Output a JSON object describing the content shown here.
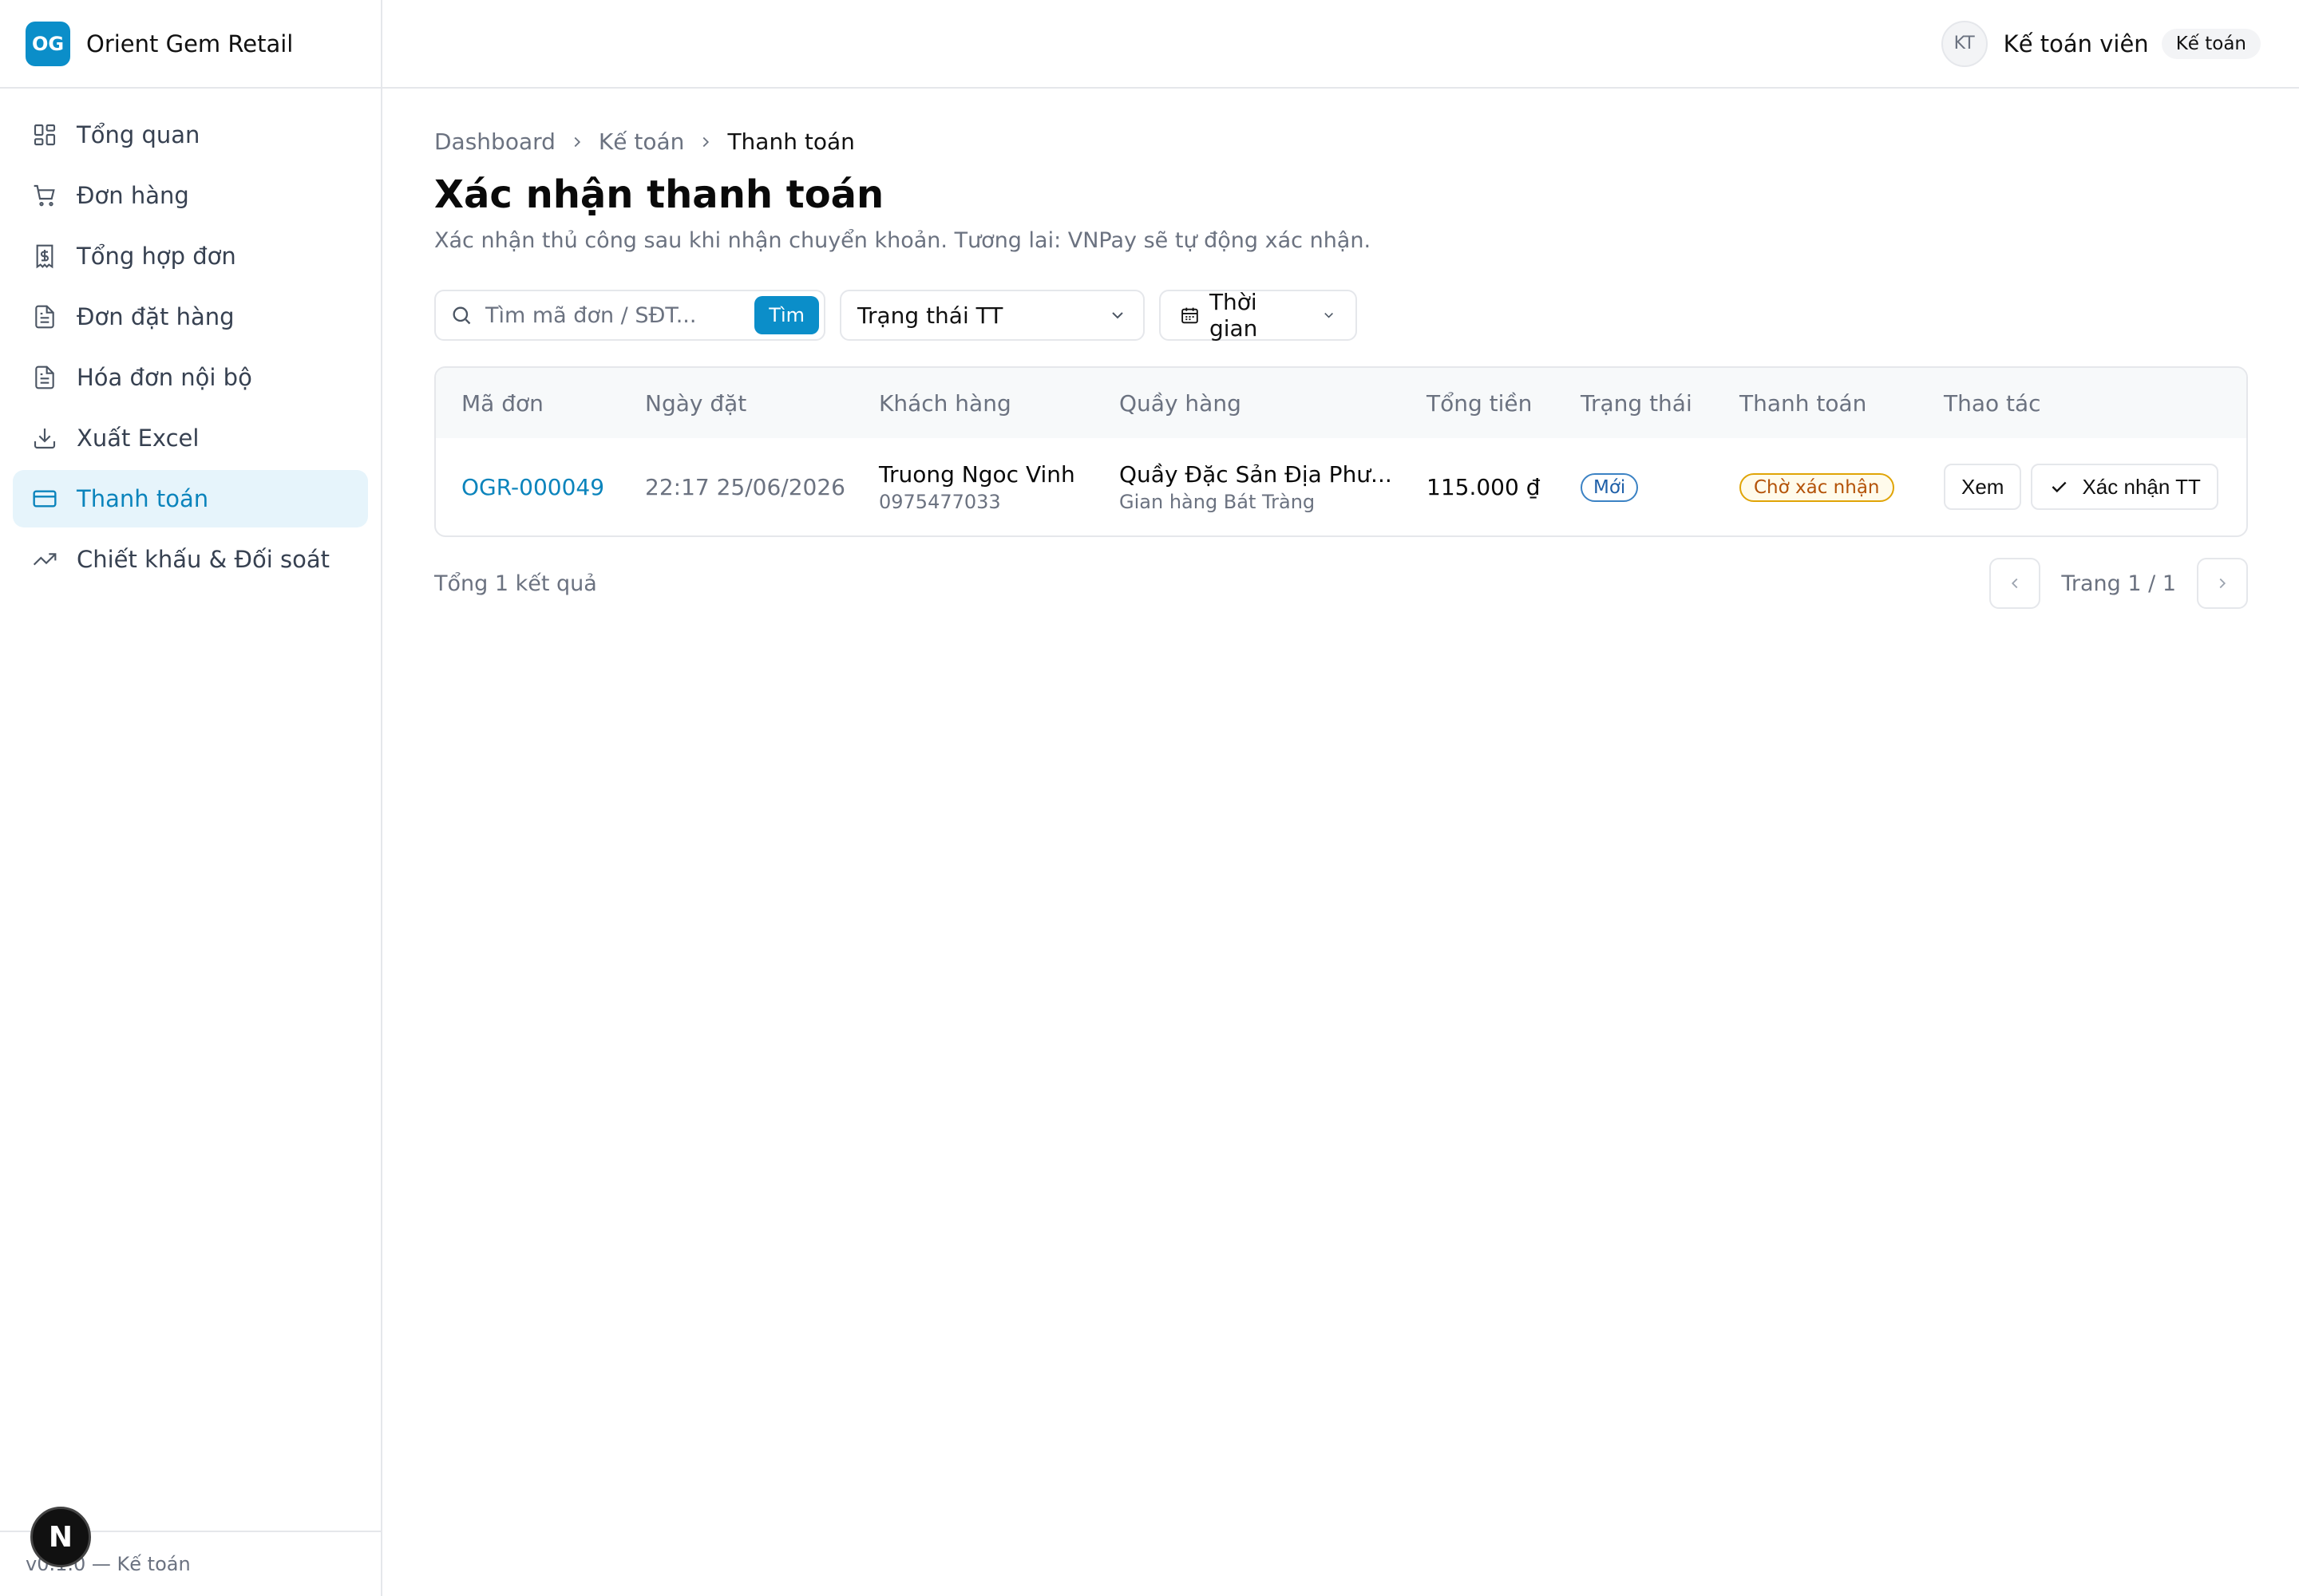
{
  "brand": {
    "logo": "OG",
    "name": "Orient Gem Retail"
  },
  "sidebar": {
    "items": [
      {
        "label": "Tổng quan",
        "icon": "dashboard-icon"
      },
      {
        "label": "Đơn hàng",
        "icon": "cart-icon"
      },
      {
        "label": "Tổng hợp đơn",
        "icon": "receipt-icon"
      },
      {
        "label": "Đơn đặt hàng",
        "icon": "document-icon"
      },
      {
        "label": "Hóa đơn nội bộ",
        "icon": "document-icon"
      },
      {
        "label": "Xuất Excel",
        "icon": "download-icon"
      },
      {
        "label": "Thanh toán",
        "icon": "credit-card-icon",
        "active": true
      },
      {
        "label": "Chiết khấu & Đối soát",
        "icon": "trending-up-icon"
      }
    ],
    "footer": "v0.1.0 — Kế toán",
    "next_badge": "N"
  },
  "topbar": {
    "avatar": "KT",
    "user_name": "Kế toán viên",
    "role": "Kế toán"
  },
  "breadcrumb": {
    "items": [
      "Dashboard",
      "Kế toán"
    ],
    "current": "Thanh toán"
  },
  "page": {
    "title": "Xác nhận thanh toán",
    "subtitle": "Xác nhận thủ công sau khi nhận chuyển khoản. Tương lai: VNPay sẽ tự động xác nhận."
  },
  "filters": {
    "search_placeholder": "Tìm mã đơn / SĐT...",
    "search_button": "Tìm",
    "status_select": "Trạng thái TT",
    "date_button": "Thời gian"
  },
  "table": {
    "columns": [
      "Mã đơn",
      "Ngày đặt",
      "Khách hàng",
      "Quầy hàng",
      "Tổng tiền",
      "Trạng thái",
      "Thanh toán",
      "Thao tác"
    ],
    "rows": [
      {
        "order_id": "OGR-000049",
        "date": "22:17 25/06/2026",
        "customer_name": "Truong Ngoc Vinh",
        "customer_phone": "0975477033",
        "counter_name": "Quầy Đặc Sản Địa Phư...",
        "counter_sub": "Gian hàng Bát Tràng",
        "total": "115.000 ₫",
        "status": "Mới",
        "payment": "Chờ xác nhận",
        "view_label": "Xem",
        "confirm_label": "Xác nhận TT"
      }
    ]
  },
  "footer": {
    "total_text": "Tổng 1 kết quả",
    "page_label": "Trang 1 / 1"
  },
  "colors": {
    "accent": "#0b8ec9",
    "active_bg": "#e6f4fb",
    "warning": "#e0a406"
  }
}
